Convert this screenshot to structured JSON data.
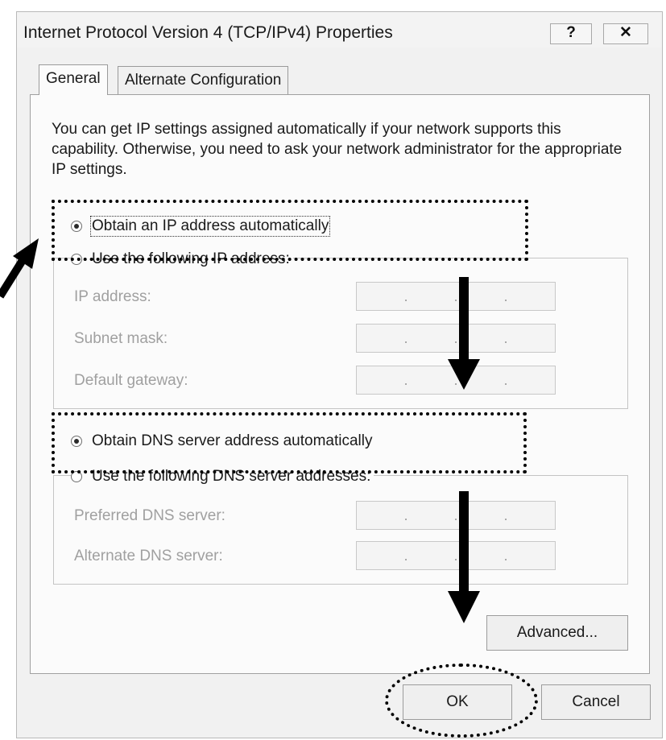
{
  "dialog": {
    "title": "Internet Protocol Version 4 (TCP/IPv4) Properties",
    "help_label": "?",
    "close_label": "✕"
  },
  "tabs": [
    {
      "label": "General"
    },
    {
      "label": "Alternate Configuration"
    }
  ],
  "description": "You can get IP settings assigned automatically if your network supports this capability. Otherwise, you need to ask your network administrator for the appropriate IP settings.",
  "ip": {
    "auto_label": "Obtain an IP address automatically",
    "manual_label": "Use the following IP address:",
    "auto_selected": true,
    "fields": [
      {
        "label": "IP address:"
      },
      {
        "label": "Subnet mask:"
      },
      {
        "label": "Default gateway:"
      }
    ]
  },
  "dns": {
    "auto_label": "Obtain DNS server address automatically",
    "manual_label": "Use the following DNS server addresses:",
    "auto_selected": true,
    "fields": [
      {
        "label": "Preferred DNS server:"
      },
      {
        "label": "Alternate DNS server:"
      }
    ]
  },
  "buttons": {
    "advanced": "Advanced...",
    "ok": "OK",
    "cancel": "Cancel"
  },
  "annotation": {
    "highlight_style": "black dotted outline",
    "arrow_color": "#000000"
  }
}
